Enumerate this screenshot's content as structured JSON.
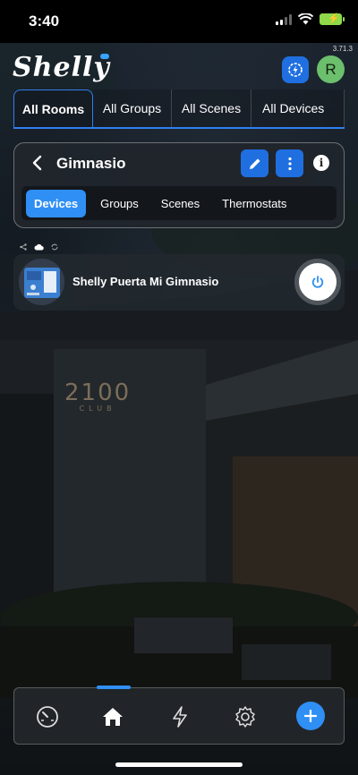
{
  "status_bar": {
    "time": "3:40"
  },
  "app": {
    "version": "3.71.3",
    "logo_text": "Shelly",
    "avatar_initial": "R"
  },
  "top_tabs": [
    {
      "label": "All Rooms",
      "active": true
    },
    {
      "label": "All Groups",
      "active": false
    },
    {
      "label": "All Scenes",
      "active": false
    },
    {
      "label": "All Devices",
      "active": false
    }
  ],
  "room": {
    "title": "Gimnasio",
    "sub_tabs": [
      {
        "label": "Devices",
        "active": true
      },
      {
        "label": "Groups",
        "active": false
      },
      {
        "label": "Scenes",
        "active": false
      },
      {
        "label": "Thermostats",
        "active": false
      }
    ]
  },
  "devices": [
    {
      "name": "Shelly Puerta Mi Gimnasio",
      "icon": "relay-device-image"
    }
  ],
  "background_sign": {
    "line1": "2100",
    "line2": "CLUB"
  },
  "colors": {
    "accent": "#2f8ff5",
    "button_blue": "#1f6fe0",
    "avatar": "#6cbf6c"
  }
}
